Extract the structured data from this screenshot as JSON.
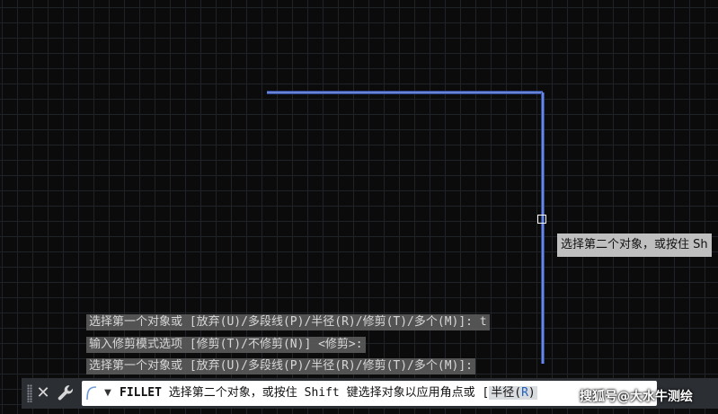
{
  "drawing": {
    "background_color": "#0b0b0b",
    "grid_color": "#1f2227",
    "line_color": "#5b78c9"
  },
  "tooltip": {
    "text": "选择第二个对象，或按住 Sh"
  },
  "command_history": [
    "选择第一个对象或 [放弃(U)/多段线(P)/半径(R)/修剪(T)/多个(M)]: t",
    "输入修剪模式选项 [修剪(T)/不修剪(N)] <修剪>:",
    "选择第一个对象或 [放弃(U)/多段线(P)/半径(R)/修剪(T)/多个(M)]:"
  ],
  "command_line": {
    "close_icon": "close-icon",
    "customize_icon": "wrench-icon",
    "dropdown_icon": "triangle-down-icon",
    "command_name": "FILLET",
    "prompt": "选择第二个对象，或按住 Shift 键选择对象以应用角点或",
    "bracket_open": "[",
    "option_label": "半径(",
    "option_key": "R",
    "option_close": ")"
  },
  "watermark": "搜狐号@大水牛测绘"
}
